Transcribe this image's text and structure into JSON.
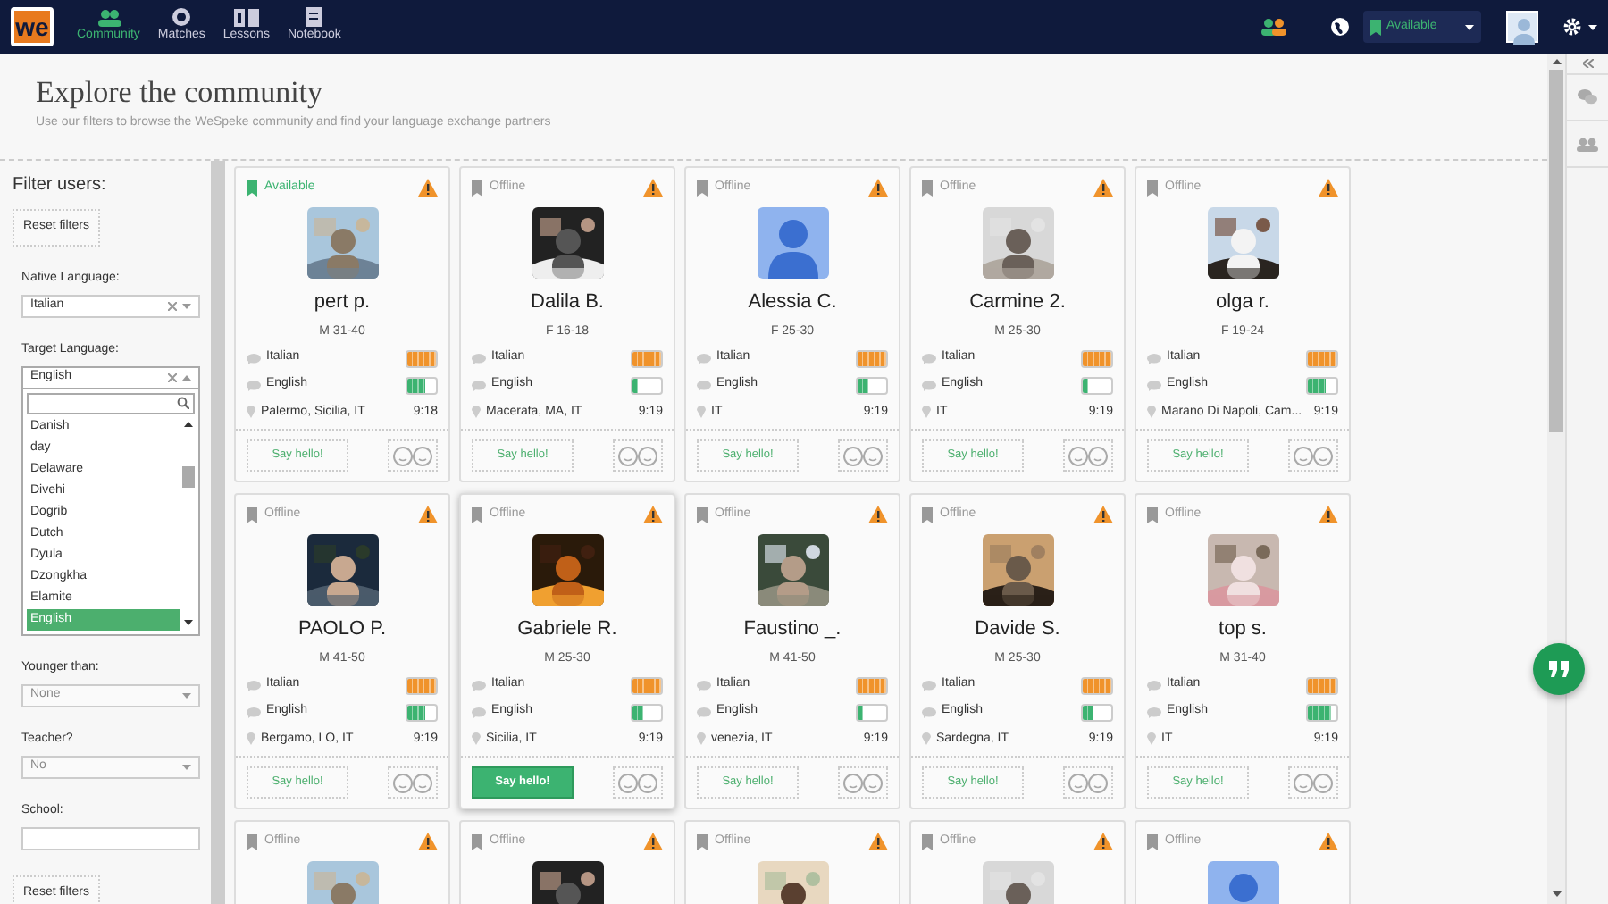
{
  "nav": {
    "logo": "we",
    "items": [
      {
        "label": "Community",
        "selected": true
      },
      {
        "label": "Matches",
        "selected": false
      },
      {
        "label": "Lessons",
        "selected": false
      },
      {
        "label": "Notebook",
        "selected": false
      }
    ],
    "status": {
      "value": "Available",
      "online": true
    }
  },
  "header": {
    "title": "Explore the community",
    "subtitle": "Use our filters to browse the WeSpeke community and find your language exchange partners"
  },
  "filters": {
    "title": "Filter users:",
    "reset_top": "Reset filters",
    "fields": [
      {
        "label": "Native Language:",
        "kind": "clearable",
        "value": "Italian",
        "expanded": false
      },
      {
        "label": "Target Language:",
        "kind": "clearable",
        "value": "English",
        "expanded": true,
        "options": [
          {
            "label": "Danish",
            "selected": false
          },
          {
            "label": "day",
            "selected": false
          },
          {
            "label": "Delaware",
            "selected": false
          },
          {
            "label": "Divehi",
            "selected": false
          },
          {
            "label": "Dogrib",
            "selected": false
          },
          {
            "label": "Dutch",
            "selected": false
          },
          {
            "label": "Dyula",
            "selected": false
          },
          {
            "label": "Dzongkha",
            "selected": false
          },
          {
            "label": "Elamite",
            "selected": false
          },
          {
            "label": "English",
            "selected": true
          }
        ]
      },
      {
        "label": "Younger than:",
        "kind": "select",
        "value": "None",
        "disabled": true
      },
      {
        "label": "Teacher?",
        "kind": "select",
        "value": "No",
        "disabled": true
      },
      {
        "label": "School:",
        "kind": "text"
      }
    ],
    "reset_bottom": "Reset filters"
  },
  "cards": [
    {
      "status": "Available",
      "online": true,
      "kind": "picture",
      "name": "pert p.",
      "age": "M 31-40",
      "languages": [
        {
          "name": "Italian",
          "kind": "native",
          "level": 1
        },
        {
          "name": "English",
          "kind": "target",
          "level": 0.6
        }
      ],
      "location": "Palermo, Sicilia, IT",
      "time": "9:18",
      "button": "Say hello!",
      "highlighted": false
    },
    {
      "status": "Offline",
      "online": false,
      "kind": "picture",
      "name": "Dalila B.",
      "age": "F 16-18",
      "languages": [
        {
          "name": "Italian",
          "kind": "native",
          "level": 1
        },
        {
          "name": "English",
          "kind": "target",
          "level": 0.2
        }
      ],
      "location": "Macerata, MA, IT",
      "time": "9:19",
      "button": "Say hello!",
      "highlighted": false
    },
    {
      "status": "Offline",
      "online": false,
      "kind": "default",
      "name": "Alessia C.",
      "age": "F 25-30",
      "languages": [
        {
          "name": "Italian",
          "kind": "native",
          "level": 1
        },
        {
          "name": "English",
          "kind": "target",
          "level": 0.4
        }
      ],
      "location": "IT",
      "time": "9:19",
      "button": "Say hello!",
      "highlighted": false
    },
    {
      "status": "Offline",
      "online": false,
      "kind": "picture",
      "name": "Carmine 2.",
      "age": "M 25-30",
      "languages": [
        {
          "name": "Italian",
          "kind": "native",
          "level": 1
        },
        {
          "name": "English",
          "kind": "target",
          "level": 0.2
        }
      ],
      "location": "IT",
      "time": "9:19",
      "button": "Say hello!",
      "highlighted": false
    },
    {
      "status": "Offline",
      "online": false,
      "kind": "picture",
      "name": "olga r.",
      "age": "F 19-24",
      "languages": [
        {
          "name": "Italian",
          "kind": "native",
          "level": 1
        },
        {
          "name": "English",
          "kind": "target",
          "level": 0.6
        }
      ],
      "location": "Marano Di Napoli, Cam...",
      "time": "9:19",
      "button": "Say hello!",
      "highlighted": false
    },
    {
      "status": "Offline",
      "online": false,
      "kind": "picture",
      "name": "PAOLO P.",
      "age": "M 41-50",
      "languages": [
        {
          "name": "Italian",
          "kind": "native",
          "level": 1
        },
        {
          "name": "English",
          "kind": "target",
          "level": 0.6
        }
      ],
      "location": "Bergamo, LO, IT",
      "time": "9:19",
      "button": "Say hello!",
      "highlighted": false
    },
    {
      "status": "Offline",
      "online": false,
      "kind": "picture",
      "name": "Gabriele R.",
      "age": "M 25-30",
      "languages": [
        {
          "name": "Italian",
          "kind": "native",
          "level": 1
        },
        {
          "name": "English",
          "kind": "target",
          "level": 0.4
        }
      ],
      "location": "Sicilia, IT",
      "time": "9:19",
      "button": "Say hello!",
      "highlighted": true
    },
    {
      "status": "Offline",
      "online": false,
      "kind": "picture",
      "name": "Faustino _.",
      "age": "M 41-50",
      "languages": [
        {
          "name": "Italian",
          "kind": "native",
          "level": 1
        },
        {
          "name": "English",
          "kind": "target",
          "level": 0.2
        }
      ],
      "location": "venezia, IT",
      "time": "9:19",
      "button": "Say hello!",
      "highlighted": false
    },
    {
      "status": "Offline",
      "online": false,
      "kind": "picture",
      "name": "Davide S.",
      "age": "M 25-30",
      "languages": [
        {
          "name": "Italian",
          "kind": "native",
          "level": 1
        },
        {
          "name": "English",
          "kind": "target",
          "level": 0.4
        }
      ],
      "location": "Sardegna, IT",
      "time": "9:19",
      "button": "Say hello!",
      "highlighted": false
    },
    {
      "status": "Offline",
      "online": false,
      "kind": "picture",
      "name": "top s.",
      "age": "M 31-40",
      "languages": [
        {
          "name": "Italian",
          "kind": "native",
          "level": 1
        },
        {
          "name": "English",
          "kind": "target",
          "level": 0.8
        }
      ],
      "location": "IT",
      "time": "9:19",
      "button": "Say hello!",
      "highlighted": false
    },
    {
      "status": "Offline",
      "online": false,
      "kind": "picture"
    },
    {
      "status": "Offline",
      "online": false,
      "kind": "picture"
    },
    {
      "status": "Offline",
      "online": false,
      "kind": "picture"
    },
    {
      "status": "Offline",
      "online": false,
      "kind": "picture"
    },
    {
      "status": "Offline",
      "online": false,
      "kind": "default"
    }
  ]
}
